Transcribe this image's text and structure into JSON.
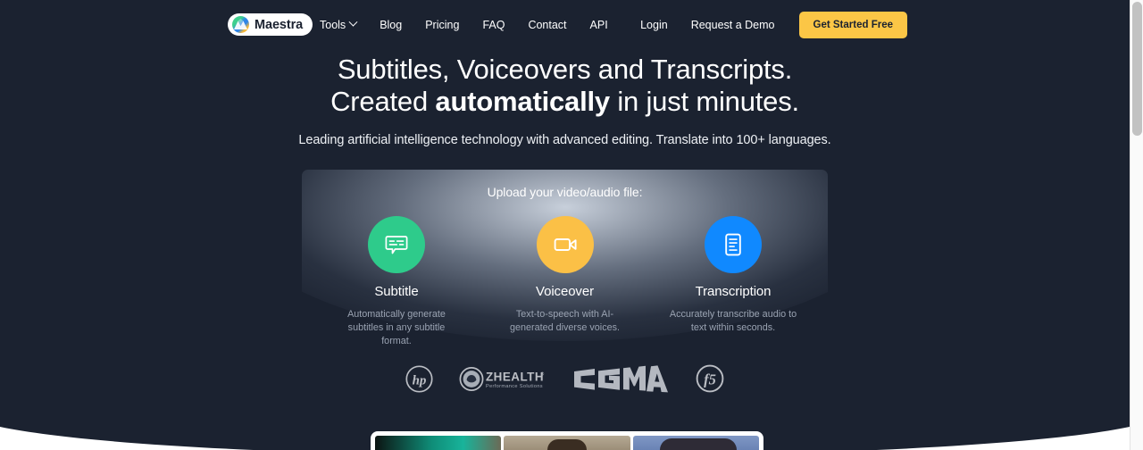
{
  "brand": {
    "name": "Maestra",
    "logo_icon": "maestra-mountain-logo-icon",
    "accent_yellow": "#fbc646",
    "accent_green": "#2ecb8b",
    "accent_blue": "#1089ff",
    "background": "#1b2230"
  },
  "nav": {
    "links": [
      {
        "label": "Tools",
        "has_dropdown": true
      },
      {
        "label": "Blog",
        "has_dropdown": false
      },
      {
        "label": "Pricing",
        "has_dropdown": false
      },
      {
        "label": "FAQ",
        "has_dropdown": false
      },
      {
        "label": "Contact",
        "has_dropdown": false
      },
      {
        "label": "API",
        "has_dropdown": false
      }
    ],
    "login_label": "Login",
    "demo_label": "Request a Demo",
    "cta_label": "Get Started Free"
  },
  "hero": {
    "line1": "Subtitles, Voiceovers and Transcripts.",
    "line2_prefix": "Created ",
    "line2_strong": "automatically",
    "line2_suffix": " in just minutes.",
    "subtitle": "Leading artificial intelligence technology with advanced editing. Translate into 100+ languages."
  },
  "upload": {
    "title": "Upload your video/audio file:",
    "cards": [
      {
        "title": "Subtitle",
        "description": "Automatically generate subtitles in any subtitle format.",
        "icon": "speech-bubble-subtitle-icon",
        "color": "#2ecb8b"
      },
      {
        "title": "Voiceover",
        "description": "Text-to-speech with AI-generated diverse voices.",
        "icon": "video-camera-icon",
        "color": "#fbc046"
      },
      {
        "title": "Transcription",
        "description": "Accurately transcribe audio to text within seconds.",
        "icon": "document-lines-icon",
        "color": "#1089ff"
      }
    ]
  },
  "clients": [
    {
      "name": "hp",
      "icon": "hp-logo-icon"
    },
    {
      "name": "ZHEALTH",
      "tagline": "Performance Solutions",
      "icon": "zhealth-logo-icon"
    },
    {
      "name": "CGMA",
      "icon": "cgma-logo-icon"
    },
    {
      "name": "f5",
      "icon": "f5-logo-icon"
    }
  ],
  "video_preview": {
    "panels": [
      "panel-teal",
      "panel-tan",
      "panel-blue"
    ]
  }
}
